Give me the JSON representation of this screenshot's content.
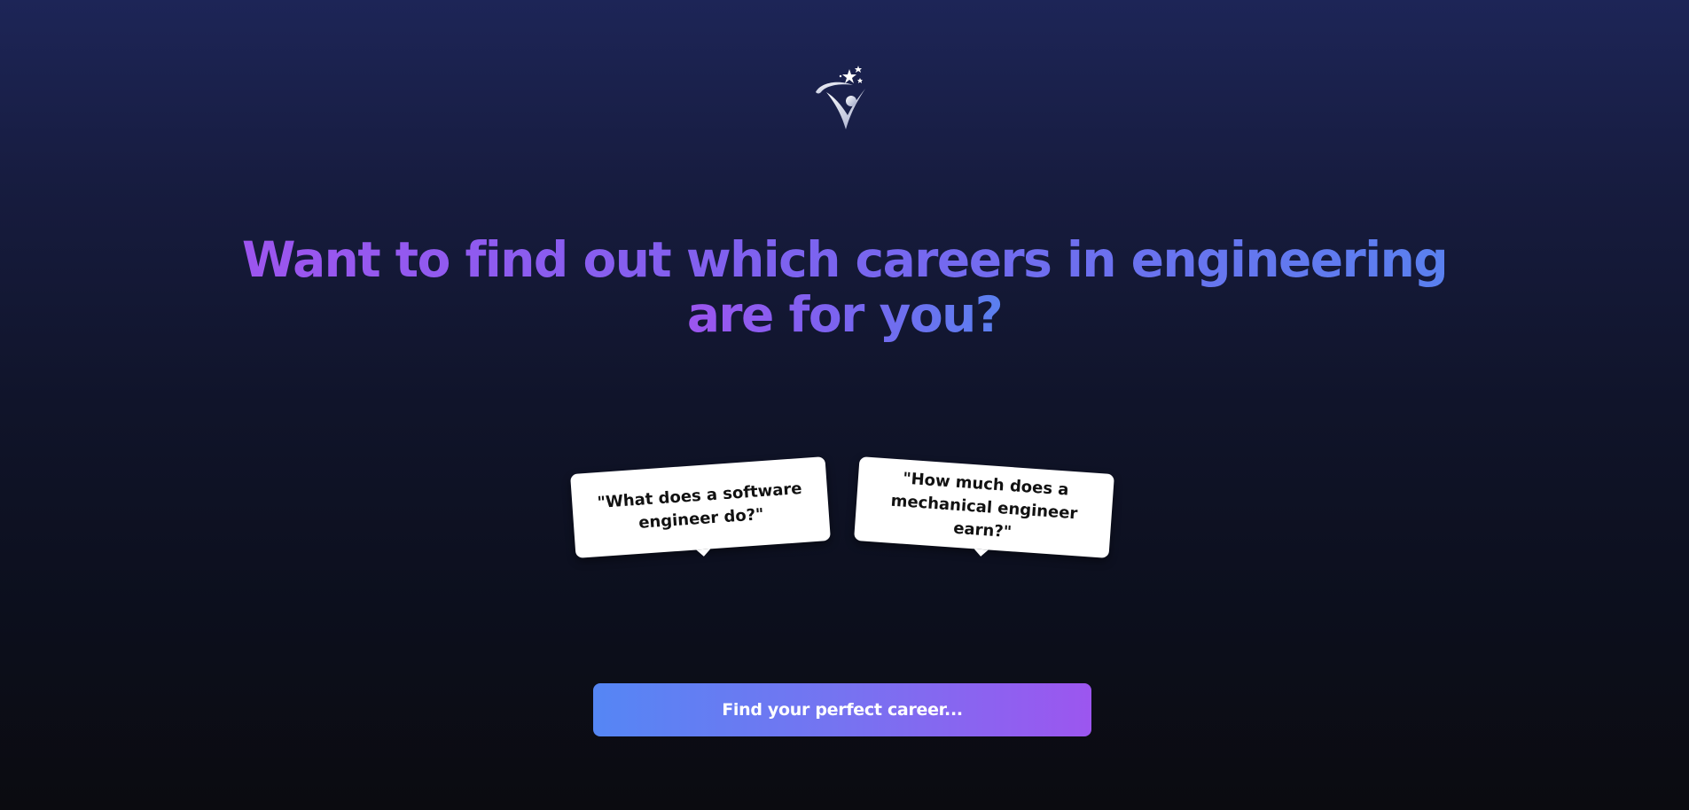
{
  "logo": {
    "icon": "star-figure-logo-icon"
  },
  "hero": {
    "line1": "Want to find out which careers in engineering",
    "line2": "are for you?"
  },
  "prompts": [
    {
      "text": "\"What does a software engineer do?\""
    },
    {
      "text": "\"How much does a mechanical engineer earn?\""
    }
  ],
  "cta": {
    "label": "Find your perfect career..."
  },
  "colors": {
    "gradient_start": "#5586f4",
    "gradient_mid": "#7673f1",
    "gradient_end": "#9c56ef",
    "bg_top": "#1d2557",
    "bg_bottom": "#0b0b10"
  }
}
